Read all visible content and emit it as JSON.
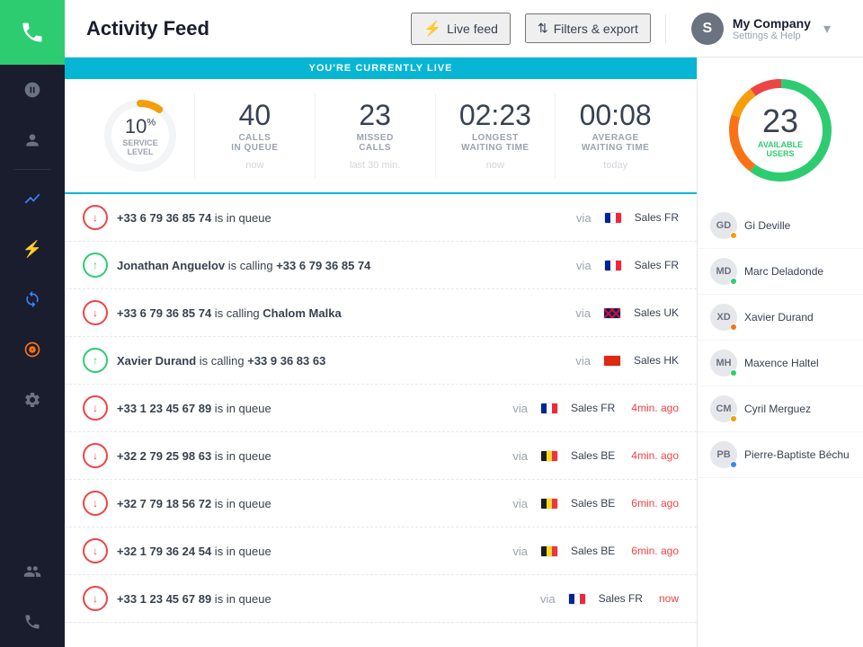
{
  "app": {
    "logo_icon": "phone",
    "title": "Activity Feed"
  },
  "sidebar": {
    "items": [
      {
        "id": "calls",
        "icon": "☎",
        "label": "Calls"
      },
      {
        "id": "contacts",
        "icon": "👤",
        "label": "Contacts"
      },
      {
        "id": "activity",
        "icon": "📊",
        "label": "Activity",
        "active": true
      },
      {
        "id": "lightning",
        "icon": "⚡",
        "label": "Lightning"
      },
      {
        "id": "sync",
        "icon": "🔄",
        "label": "Sync"
      },
      {
        "id": "target",
        "icon": "🎯",
        "label": "Target"
      },
      {
        "id": "settings-sm",
        "icon": "⚙",
        "label": "Settings"
      },
      {
        "id": "users-sm",
        "icon": "👥",
        "label": "Users"
      },
      {
        "id": "phone-sm",
        "icon": "📞",
        "label": "Phone"
      }
    ]
  },
  "header": {
    "title": "Activity Feed",
    "live_feed_label": "Live feed",
    "filters_label": "Filters & export",
    "company_initial": "S",
    "company_name": "My Company",
    "company_sub": "Settings & Help"
  },
  "stats": {
    "live_banner": "YOU'RE CURRENTLY LIVE",
    "service_level": {
      "value": "10",
      "unit": "%",
      "label": "SERVICE",
      "label2": "LEVEL",
      "percent": 10
    },
    "calls_in_queue": {
      "value": "40",
      "label": "CALLS",
      "sublabel": "IN QUEUE",
      "time": "now"
    },
    "missed_calls": {
      "value": "23",
      "label": "MISSED",
      "sublabel": "CALLS",
      "time": "last 30 min."
    },
    "longest_waiting": {
      "value": "02:23",
      "label": "LONGEST",
      "sublabel": "WAITING TIME",
      "time": "now"
    },
    "average_waiting": {
      "value": "00:08",
      "label": "AVERAGE",
      "sublabel": "WAITING TIME",
      "time": "today"
    }
  },
  "available_users": {
    "value": "23",
    "label": "AVAILABLE",
    "label2": "USERS"
  },
  "feed_items": [
    {
      "id": 1,
      "type": "inbound",
      "number": "+33 6 79 36 85 74",
      "status": "is in queue",
      "caller": null,
      "callee": null,
      "via": "via",
      "flag": "fr",
      "channel": "Sales FR",
      "time": ""
    },
    {
      "id": 2,
      "type": "outbound",
      "number": null,
      "status": "is calling",
      "caller": "Jonathan Anguelov",
      "callee": "+33 6 79 36 85 74",
      "via": "via",
      "flag": "fr",
      "channel": "Sales FR",
      "time": ""
    },
    {
      "id": 3,
      "type": "inbound",
      "number": "+33 6 79 36 85 74",
      "status": "is calling",
      "caller": null,
      "callee": "Chalom Malka",
      "via": "via",
      "flag": "uk",
      "channel": "Sales UK",
      "time": ""
    },
    {
      "id": 4,
      "type": "outbound",
      "number": null,
      "status": "is calling",
      "caller": "Xavier Durand",
      "callee": "+33 9 36 83 63",
      "via": "via",
      "flag": "hk",
      "channel": "Sales HK",
      "time": ""
    },
    {
      "id": 5,
      "type": "inbound",
      "number": "+33 1 23 45 67 89",
      "status": "is in queue",
      "caller": null,
      "callee": null,
      "via": "via",
      "flag": "fr",
      "channel": "Sales FR",
      "time": "4min. ago"
    },
    {
      "id": 6,
      "type": "inbound",
      "number": "+32 2 79 25 98 63",
      "status": "is in queue",
      "caller": null,
      "callee": null,
      "via": "via",
      "flag": "be",
      "channel": "Sales BE",
      "time": "4min. ago"
    },
    {
      "id": 7,
      "type": "inbound",
      "number": "+32 7 79 18 56 72",
      "status": "is in queue",
      "caller": null,
      "callee": null,
      "via": "via",
      "flag": "be",
      "channel": "Sales BE",
      "time": "6min. ago"
    },
    {
      "id": 8,
      "type": "inbound",
      "number": "+32 1 79 36 24 54",
      "status": "is in queue",
      "caller": null,
      "callee": null,
      "via": "via",
      "flag": "be",
      "channel": "Sales BE",
      "time": "6min. ago"
    },
    {
      "id": 9,
      "type": "inbound",
      "number": "+33 1 23 45 67 89",
      "status": "is in queue",
      "caller": null,
      "callee": null,
      "via": "via",
      "flag": "fr",
      "channel": "Sales FR",
      "time": "now"
    }
  ],
  "users": [
    {
      "id": 1,
      "name": "Gi Deville",
      "initials": "GD",
      "status": "yellow"
    },
    {
      "id": 2,
      "name": "Marc Deladonde",
      "initials": "MD",
      "status": "green"
    },
    {
      "id": 3,
      "name": "Xavier Durand",
      "initials": "XD",
      "status": "orange"
    },
    {
      "id": 4,
      "name": "Maxence Haltel",
      "initials": "MH",
      "status": "green"
    },
    {
      "id": 5,
      "name": "Cyril Merguez",
      "initials": "CM",
      "status": "yellow"
    },
    {
      "id": 6,
      "name": "Pierre-Baptiste Béchu",
      "initials": "PB",
      "status": "blue"
    }
  ]
}
